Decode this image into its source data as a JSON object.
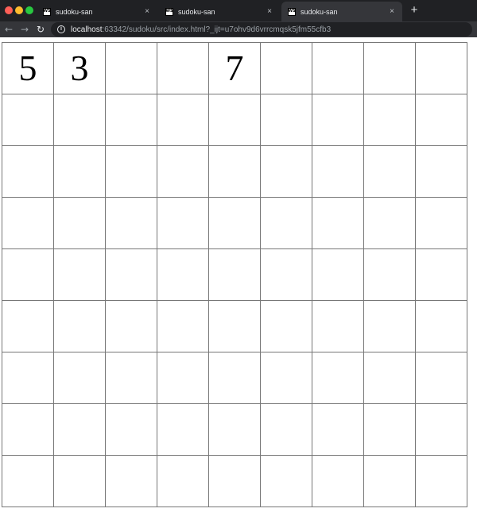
{
  "window": {
    "controls": [
      "close",
      "minimize",
      "maximize"
    ]
  },
  "tabs": [
    {
      "title": "sudoku-san",
      "favicon": "WS",
      "active": false
    },
    {
      "title": "sudoku-san",
      "favicon": "WS",
      "active": false
    },
    {
      "title": "sudoku-san",
      "favicon": "WS",
      "active": true
    }
  ],
  "tab_close_glyph": "×",
  "new_tab_glyph": "+",
  "toolbar": {
    "back_glyph": "←",
    "forward_glyph": "→",
    "reload_glyph": "↻",
    "info_glyph": "i",
    "url_host": "localhost",
    "url_rest": ":63342/sudoku/src/index.html?_ijt=u7ohv9d6vrrcmqsk5jfm55cfb3"
  },
  "sudoku": {
    "rows": [
      [
        "5",
        "3",
        "",
        "",
        "7",
        "",
        "",
        "",
        ""
      ],
      [
        "",
        "",
        "",
        "",
        "",
        "",
        "",
        "",
        ""
      ],
      [
        "",
        "",
        "",
        "",
        "",
        "",
        "",
        "",
        ""
      ],
      [
        "",
        "",
        "",
        "",
        "",
        "",
        "",
        "",
        ""
      ],
      [
        "",
        "",
        "",
        "",
        "",
        "",
        "",
        "",
        ""
      ],
      [
        "",
        "",
        "",
        "",
        "",
        "",
        "",
        "",
        ""
      ],
      [
        "",
        "",
        "",
        "",
        "",
        "",
        "",
        "",
        ""
      ],
      [
        "",
        "",
        "",
        "",
        "",
        "",
        "",
        "",
        ""
      ],
      [
        "",
        "",
        "",
        "",
        "",
        "",
        "",
        "",
        ""
      ]
    ]
  }
}
